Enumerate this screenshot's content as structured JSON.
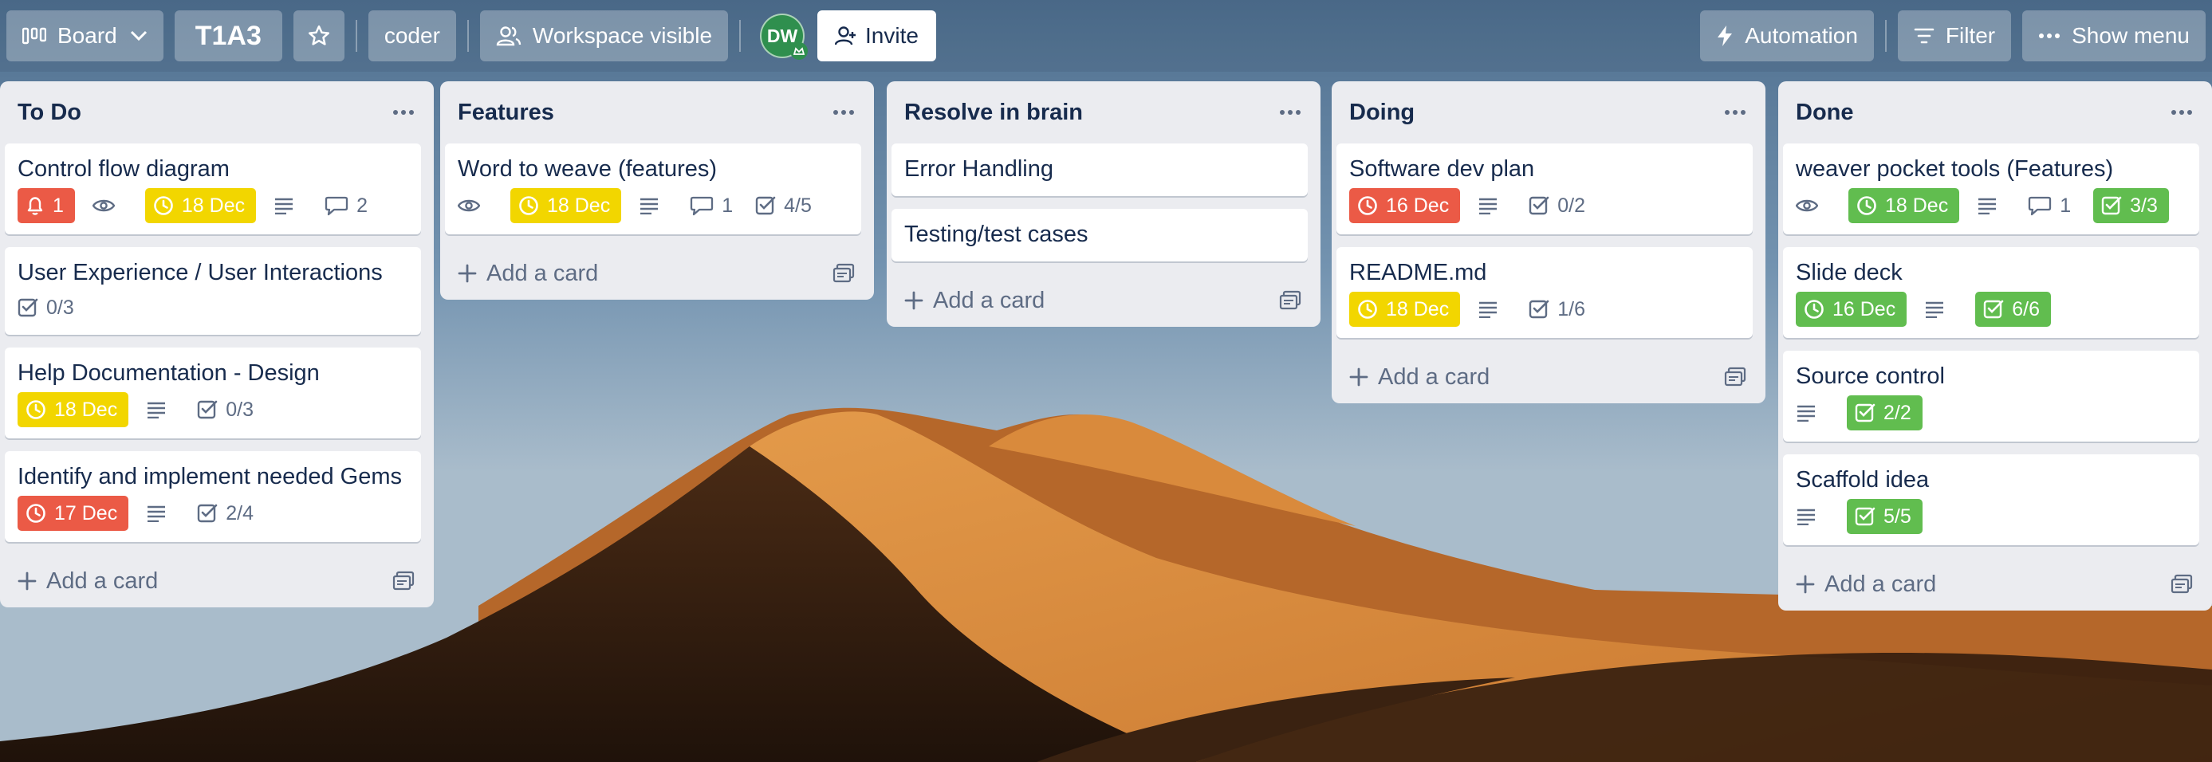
{
  "topbar": {
    "view_label": "Board",
    "board_title": "T1A3",
    "workspace_label": "coder",
    "visibility_label": "Workspace visible",
    "avatar_initials": "DW",
    "invite_label": "Invite",
    "automation_label": "Automation",
    "filter_label": "Filter",
    "menu_label": "Show menu"
  },
  "colors": {
    "red_label": "#eb5a46",
    "yellow_label": "#f2d600",
    "green_label": "#61bd4f",
    "list_bg": "#ebecf0",
    "avatar": "#2f8f4e"
  },
  "lists": [
    {
      "title": "To Do",
      "add_label": "Add a card",
      "cards": [
        {
          "title": "Control flow diagram",
          "notifications": "1",
          "watching": true,
          "due": "18 Dec",
          "due_color": "yellow",
          "description": true,
          "comments": "2"
        },
        {
          "title": "User Experience / User Interactions",
          "checklist": "0/3"
        },
        {
          "title": "Help Documentation - Design",
          "due": "18 Dec",
          "due_color": "yellow",
          "description": true,
          "checklist": "0/3"
        },
        {
          "title": "Identify and implement needed Gems",
          "due": "17 Dec",
          "due_color": "red",
          "description": true,
          "checklist": "2/4"
        }
      ]
    },
    {
      "title": "Features",
      "add_label": "Add a card",
      "cards": [
        {
          "title": "Word to weave (features)",
          "watching": true,
          "due": "18 Dec",
          "due_color": "yellow",
          "description": true,
          "comments": "1",
          "checklist": "4/5"
        }
      ]
    },
    {
      "title": "Resolve in brain",
      "add_label": "Add a card",
      "cards": [
        {
          "title": "Error Handling"
        },
        {
          "title": "Testing/test cases"
        }
      ]
    },
    {
      "title": "Doing",
      "add_label": "Add a card",
      "cards": [
        {
          "title": "Software dev plan",
          "due": "16 Dec",
          "due_color": "red",
          "description": true,
          "checklist": "0/2"
        },
        {
          "title": "README.md",
          "due": "18 Dec",
          "due_color": "yellow",
          "description": true,
          "checklist": "1/6"
        }
      ]
    },
    {
      "title": "Done",
      "add_label": "Add a card",
      "cards": [
        {
          "title": "weaver pocket tools (Features)",
          "watching": true,
          "due": "18 Dec",
          "due_color": "green",
          "description": true,
          "comments": "1",
          "checklist": "3/3",
          "checklist_complete": true
        },
        {
          "title": "Slide deck",
          "due": "16 Dec",
          "due_color": "green",
          "description": true,
          "checklist": "6/6",
          "checklist_complete": true
        },
        {
          "title": "Source control",
          "description": true,
          "checklist": "2/2",
          "checklist_complete": true
        },
        {
          "title": "Scaffold idea",
          "description": true,
          "checklist": "5/5",
          "checklist_complete": true
        }
      ]
    }
  ]
}
